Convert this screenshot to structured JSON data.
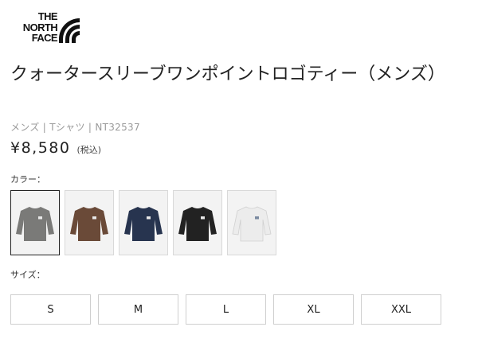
{
  "brand": {
    "logo_text": "THE\nNORTH\nFACE"
  },
  "product": {
    "title": "クォータースリーブワンポイントロゴティー（メンズ）",
    "meta": "メンズ | Tシャツ | NT32537",
    "price": "¥8,580",
    "tax_note": "(税込)"
  },
  "color": {
    "label": "カラー：",
    "swatches": [
      {
        "icon": "tshirt-icon",
        "shirt_color": "#7a7a78",
        "selected": true
      },
      {
        "icon": "tshirt-icon",
        "shirt_color": "#6a4a38",
        "selected": false
      },
      {
        "icon": "tshirt-icon",
        "shirt_color": "#27344f",
        "selected": false
      },
      {
        "icon": "tshirt-icon",
        "shirt_color": "#222222",
        "selected": false
      },
      {
        "icon": "tshirt-icon",
        "shirt_color": "#ececec",
        "selected": false
      }
    ]
  },
  "size": {
    "label": "サイズ：",
    "options": [
      "S",
      "M",
      "L",
      "XL",
      "XXL"
    ]
  }
}
